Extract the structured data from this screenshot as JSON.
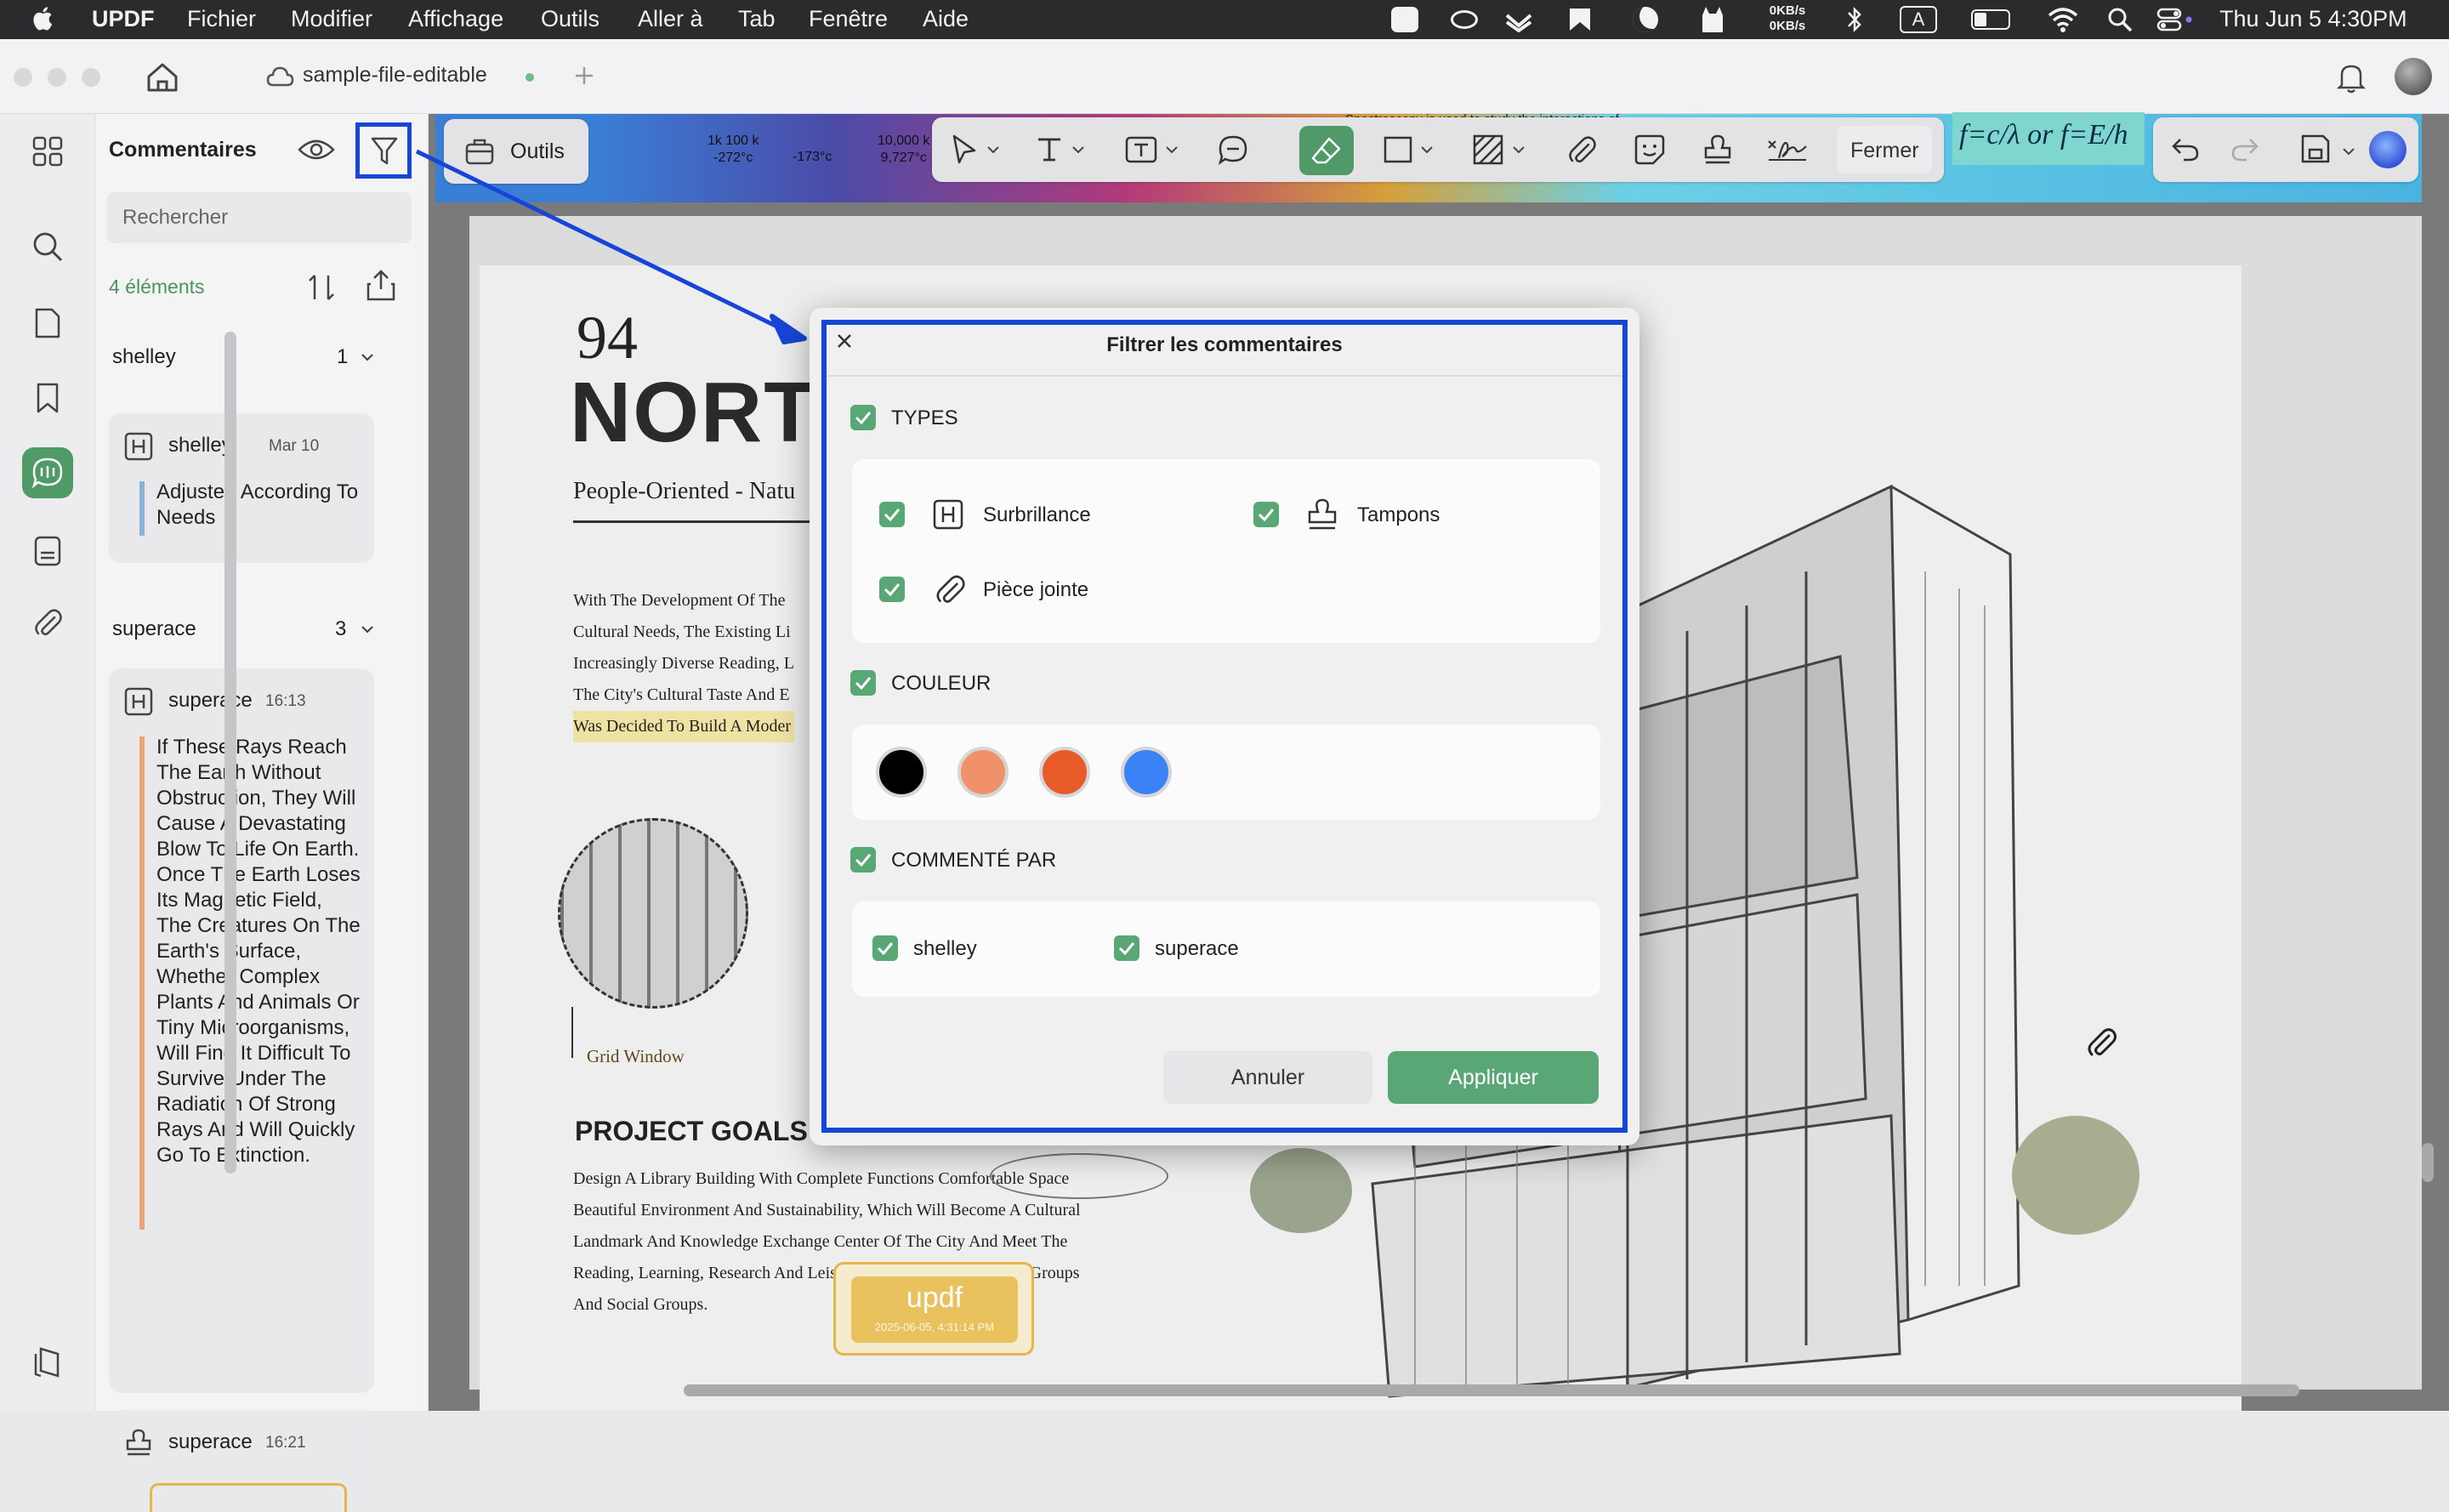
{
  "menubar": {
    "app": "UPDF",
    "items": [
      "Fichier",
      "Modifier",
      "Affichage",
      "Outils",
      "Aller à",
      "Tab",
      "Fenêtre",
      "Aide"
    ],
    "net_up": "0KB/s",
    "net_down": "0KB/s",
    "input_source": "A",
    "clock": "Thu Jun 5  4:30PM"
  },
  "tab": {
    "filename": "sample-file-editable"
  },
  "panel": {
    "title": "Commentaires",
    "search_placeholder": "Rechercher",
    "count": "4 éléments",
    "groups": [
      {
        "author": "shelley",
        "count": "1"
      },
      {
        "author": "superace",
        "count": "3"
      }
    ],
    "comments": [
      {
        "author": "shelley",
        "time": "Mar 10",
        "text": "Adjusted According To Needs"
      },
      {
        "author": "superace",
        "time": "16:13",
        "text": "If These Rays Reach The Earth Without Obstruction, They Will Cause A Devastating Blow To Life On Earth. Once The Earth Loses Its Magnetic Field, The Creatures On The Earth's Surface, Whether Complex Plants And Animals Or Tiny Microorganisms, Will Find It Difficult To Survive Under The Radiation Of Strong Rays And Will Quickly Go To Extinction."
      },
      {
        "author": "superace",
        "time": "16:21",
        "text": ""
      }
    ]
  },
  "toolbar": {
    "tools_label": "Outils",
    "close_label": "Fermer",
    "formula": "f=c/λ or f=E/h"
  },
  "spectrum": {
    "label1a": "1k 100 k",
    "label1b": "-272°c",
    "label2b": "-173°c",
    "label3a": "10,000 k",
    "label3b": "9,727°c",
    "caption": "Spectroscopy is used to study the interactions of"
  },
  "document": {
    "number": "94",
    "title": "NORT",
    "subtitle": "People-Oriented - Natu",
    "paragraph": [
      "With The Development Of The",
      "Cultural Needs, The Existing Li",
      "Increasingly Diverse Reading, L",
      "The City's Cultural Taste And E",
      "Was Decided To Build A Moder"
    ],
    "grid_label": "Grid Window",
    "goals_heading": "PROJECT GOALS",
    "goals_text": [
      "Design A Library Building With Complete Functions Comfortable Space",
      "Beautiful Environment And Sustainability, Which Will Become A Cultural",
      "Landmark And Knowledge Exchange Center Of The City And Meet The",
      "Reading, Learning, Research And Leisure Needs Of Different Age Groups",
      "And Social Groups."
    ],
    "stamp_text": "updf",
    "stamp_date": "2025-06-05, 4:31:14 PM"
  },
  "dialog": {
    "title": "Filtrer les commentaires",
    "types_label": "TYPES",
    "type_highlight": "Surbrillance",
    "type_stamps": "Tampons",
    "type_attachment": "Pièce jointe",
    "color_label": "COULEUR",
    "colors": [
      "#000000",
      "#f0916a",
      "#e85a28",
      "#3b82f6"
    ],
    "commented_by_label": "COMMENTÉ PAR",
    "author1": "shelley",
    "author2": "superace",
    "cancel": "Annuler",
    "apply": "Appliquer"
  },
  "colors": {
    "accent_green": "#5aa776",
    "annotation_blue": "#1746d6",
    "highlight_yellow": "#efe3a4"
  }
}
